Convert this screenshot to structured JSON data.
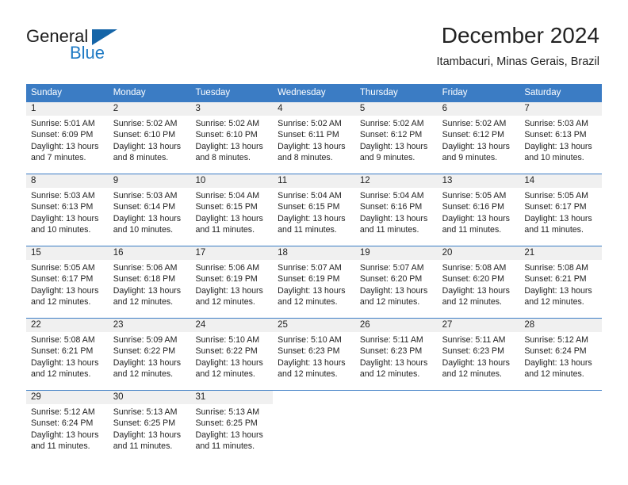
{
  "brand": {
    "name_part1": "General",
    "name_part2": "Blue",
    "triangle_icon": "blue-triangle-logo-mark",
    "color_dark": "#1d1d1d",
    "color_blue": "#1f7ac4"
  },
  "header": {
    "title": "December 2024",
    "subtitle": "Itambacuri, Minas Gerais, Brazil"
  },
  "theme": {
    "header_blue": "#3b7cc4",
    "day_band_gray": "#f0f0f0",
    "text": "#222222"
  },
  "weekdays": [
    "Sunday",
    "Monday",
    "Tuesday",
    "Wednesday",
    "Thursday",
    "Friday",
    "Saturday"
  ],
  "weeks": [
    [
      {
        "day": "1",
        "lines": [
          "Sunrise: 5:01 AM",
          "Sunset: 6:09 PM",
          "Daylight: 13 hours",
          "and 7 minutes."
        ]
      },
      {
        "day": "2",
        "lines": [
          "Sunrise: 5:02 AM",
          "Sunset: 6:10 PM",
          "Daylight: 13 hours",
          "and 8 minutes."
        ]
      },
      {
        "day": "3",
        "lines": [
          "Sunrise: 5:02 AM",
          "Sunset: 6:10 PM",
          "Daylight: 13 hours",
          "and 8 minutes."
        ]
      },
      {
        "day": "4",
        "lines": [
          "Sunrise: 5:02 AM",
          "Sunset: 6:11 PM",
          "Daylight: 13 hours",
          "and 8 minutes."
        ]
      },
      {
        "day": "5",
        "lines": [
          "Sunrise: 5:02 AM",
          "Sunset: 6:12 PM",
          "Daylight: 13 hours",
          "and 9 minutes."
        ]
      },
      {
        "day": "6",
        "lines": [
          "Sunrise: 5:02 AM",
          "Sunset: 6:12 PM",
          "Daylight: 13 hours",
          "and 9 minutes."
        ]
      },
      {
        "day": "7",
        "lines": [
          "Sunrise: 5:03 AM",
          "Sunset: 6:13 PM",
          "Daylight: 13 hours",
          "and 10 minutes."
        ]
      }
    ],
    [
      {
        "day": "8",
        "lines": [
          "Sunrise: 5:03 AM",
          "Sunset: 6:13 PM",
          "Daylight: 13 hours",
          "and 10 minutes."
        ]
      },
      {
        "day": "9",
        "lines": [
          "Sunrise: 5:03 AM",
          "Sunset: 6:14 PM",
          "Daylight: 13 hours",
          "and 10 minutes."
        ]
      },
      {
        "day": "10",
        "lines": [
          "Sunrise: 5:04 AM",
          "Sunset: 6:15 PM",
          "Daylight: 13 hours",
          "and 11 minutes."
        ]
      },
      {
        "day": "11",
        "lines": [
          "Sunrise: 5:04 AM",
          "Sunset: 6:15 PM",
          "Daylight: 13 hours",
          "and 11 minutes."
        ]
      },
      {
        "day": "12",
        "lines": [
          "Sunrise: 5:04 AM",
          "Sunset: 6:16 PM",
          "Daylight: 13 hours",
          "and 11 minutes."
        ]
      },
      {
        "day": "13",
        "lines": [
          "Sunrise: 5:05 AM",
          "Sunset: 6:16 PM",
          "Daylight: 13 hours",
          "and 11 minutes."
        ]
      },
      {
        "day": "14",
        "lines": [
          "Sunrise: 5:05 AM",
          "Sunset: 6:17 PM",
          "Daylight: 13 hours",
          "and 11 minutes."
        ]
      }
    ],
    [
      {
        "day": "15",
        "lines": [
          "Sunrise: 5:05 AM",
          "Sunset: 6:17 PM",
          "Daylight: 13 hours",
          "and 12 minutes."
        ]
      },
      {
        "day": "16",
        "lines": [
          "Sunrise: 5:06 AM",
          "Sunset: 6:18 PM",
          "Daylight: 13 hours",
          "and 12 minutes."
        ]
      },
      {
        "day": "17",
        "lines": [
          "Sunrise: 5:06 AM",
          "Sunset: 6:19 PM",
          "Daylight: 13 hours",
          "and 12 minutes."
        ]
      },
      {
        "day": "18",
        "lines": [
          "Sunrise: 5:07 AM",
          "Sunset: 6:19 PM",
          "Daylight: 13 hours",
          "and 12 minutes."
        ]
      },
      {
        "day": "19",
        "lines": [
          "Sunrise: 5:07 AM",
          "Sunset: 6:20 PM",
          "Daylight: 13 hours",
          "and 12 minutes."
        ]
      },
      {
        "day": "20",
        "lines": [
          "Sunrise: 5:08 AM",
          "Sunset: 6:20 PM",
          "Daylight: 13 hours",
          "and 12 minutes."
        ]
      },
      {
        "day": "21",
        "lines": [
          "Sunrise: 5:08 AM",
          "Sunset: 6:21 PM",
          "Daylight: 13 hours",
          "and 12 minutes."
        ]
      }
    ],
    [
      {
        "day": "22",
        "lines": [
          "Sunrise: 5:08 AM",
          "Sunset: 6:21 PM",
          "Daylight: 13 hours",
          "and 12 minutes."
        ]
      },
      {
        "day": "23",
        "lines": [
          "Sunrise: 5:09 AM",
          "Sunset: 6:22 PM",
          "Daylight: 13 hours",
          "and 12 minutes."
        ]
      },
      {
        "day": "24",
        "lines": [
          "Sunrise: 5:10 AM",
          "Sunset: 6:22 PM",
          "Daylight: 13 hours",
          "and 12 minutes."
        ]
      },
      {
        "day": "25",
        "lines": [
          "Sunrise: 5:10 AM",
          "Sunset: 6:23 PM",
          "Daylight: 13 hours",
          "and 12 minutes."
        ]
      },
      {
        "day": "26",
        "lines": [
          "Sunrise: 5:11 AM",
          "Sunset: 6:23 PM",
          "Daylight: 13 hours",
          "and 12 minutes."
        ]
      },
      {
        "day": "27",
        "lines": [
          "Sunrise: 5:11 AM",
          "Sunset: 6:23 PM",
          "Daylight: 13 hours",
          "and 12 minutes."
        ]
      },
      {
        "day": "28",
        "lines": [
          "Sunrise: 5:12 AM",
          "Sunset: 6:24 PM",
          "Daylight: 13 hours",
          "and 12 minutes."
        ]
      }
    ],
    [
      {
        "day": "29",
        "lines": [
          "Sunrise: 5:12 AM",
          "Sunset: 6:24 PM",
          "Daylight: 13 hours",
          "and 11 minutes."
        ]
      },
      {
        "day": "30",
        "lines": [
          "Sunrise: 5:13 AM",
          "Sunset: 6:25 PM",
          "Daylight: 13 hours",
          "and 11 minutes."
        ]
      },
      {
        "day": "31",
        "lines": [
          "Sunrise: 5:13 AM",
          "Sunset: 6:25 PM",
          "Daylight: 13 hours",
          "and 11 minutes."
        ]
      },
      {
        "day": "",
        "lines": []
      },
      {
        "day": "",
        "lines": []
      },
      {
        "day": "",
        "lines": []
      },
      {
        "day": "",
        "lines": []
      }
    ]
  ]
}
